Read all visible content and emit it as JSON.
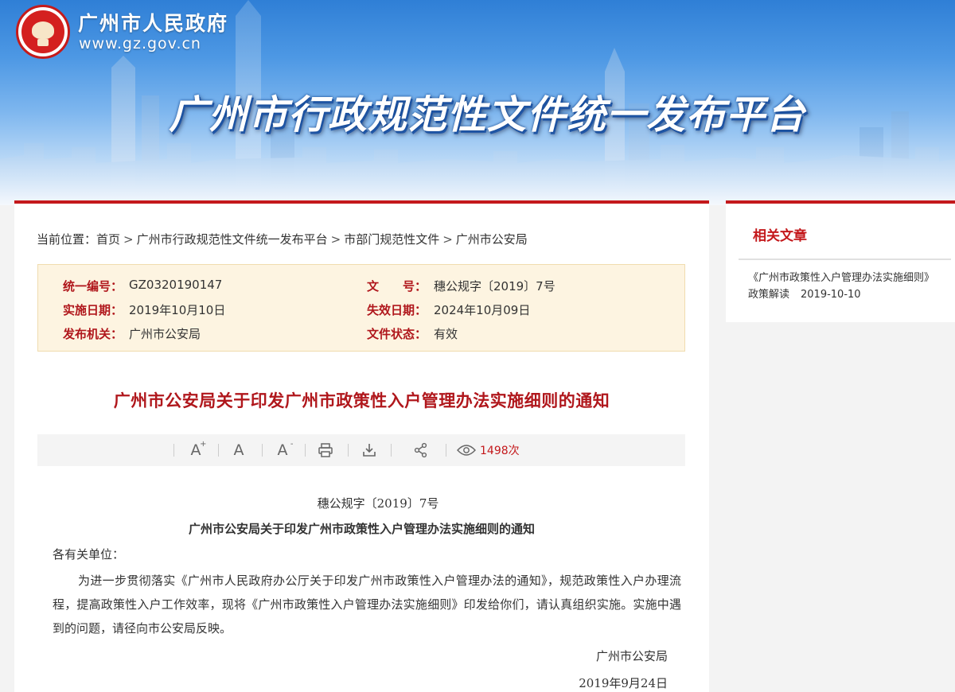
{
  "site": {
    "name": "广州市人民政府",
    "url": "www.gz.gov.cn",
    "platform_title": "广州市行政规范性文件统一发布平台"
  },
  "breadcrumb": {
    "prefix": "当前位置：",
    "separator": ">",
    "items": [
      "首页",
      "广州市行政规范性文件统一发布平台",
      "市部门规范性文件",
      "广州市公安局"
    ]
  },
  "meta": {
    "serial_label": "统一编号：",
    "serial_value": "GZ0320190147",
    "docno_label": "文　　号：",
    "docno_value": "穗公规字〔2019〕7号",
    "effective_label": "实施日期：",
    "effective_value": "2019年10月10日",
    "expire_label": "失效日期：",
    "expire_value": "2024年10月09日",
    "issuer_label": "发布机关：",
    "issuer_value": "广州市公安局",
    "status_label": "文件状态：",
    "status_value": "有效"
  },
  "document": {
    "title": "广州市公安局关于印发广州市政策性入户管理办法实施细则的通知",
    "number": "穗公规字〔2019〕7号",
    "subtitle": "广州市公安局关于印发广州市政策性入户管理办法实施细则的通知",
    "salutation": "各有关单位：",
    "body": "为进一步贯彻落实《广州市人民政府办公厅关于印发广州市政策性入户管理办法的通知》，规范政策性入户办理流程，提高政策性入户工作效率，现将《广州市政策性入户管理办法实施细则》印发给你们，请认真组织实施。实施中遇到的问题，请径向市公安局反映。",
    "signer": "广州市公安局",
    "date": "2019年9月24日"
  },
  "toolbar": {
    "icons": [
      "font-increase-icon",
      "font-reset-icon",
      "font-decrease-icon",
      "print-icon",
      "download-icon",
      "share-icon",
      "eye-icon"
    ],
    "font_glyph": "A",
    "plus_glyph": "+",
    "minus_glyph": "-",
    "views": "1498次"
  },
  "sidebar": {
    "title": "相关文章",
    "articles": [
      {
        "title": "《广州市政策性入户管理办法实施细则》政策解读",
        "date": "2019-10-10"
      }
    ]
  },
  "colors": {
    "accent_red": "#c4191c",
    "label_red": "#b0171c",
    "meta_bg": "#fdf4e1",
    "views_red": "#c4191c"
  }
}
